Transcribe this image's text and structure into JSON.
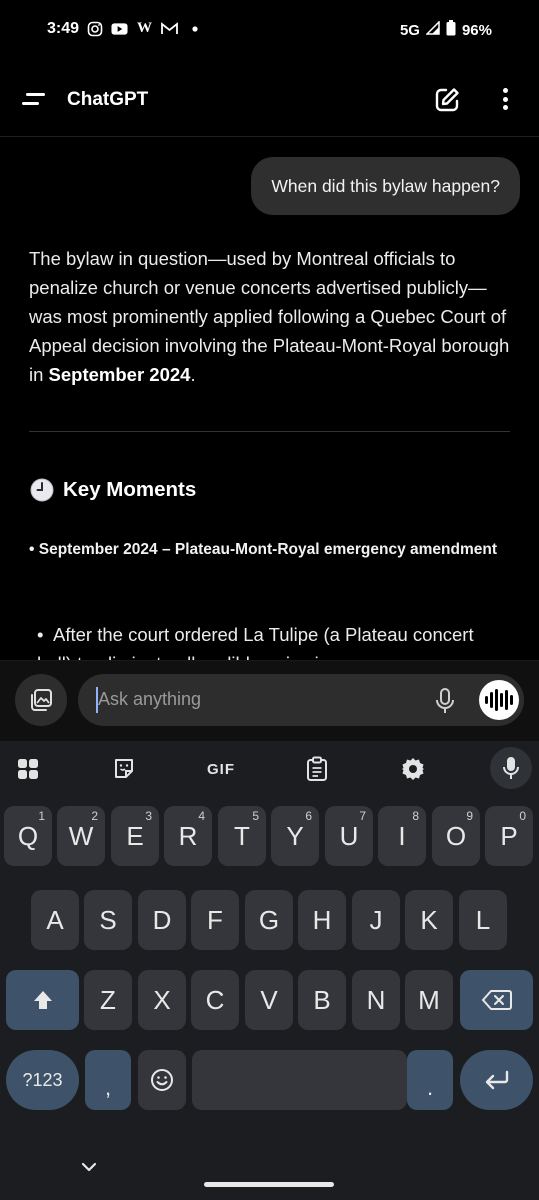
{
  "status_bar": {
    "time": "3:49",
    "notif_icons": [
      "instagram-icon",
      "youtube-icon",
      "w-icon",
      "gmail-icon",
      "dot-icon"
    ],
    "network": "5G",
    "battery": "96%"
  },
  "app_bar": {
    "title": "ChatGPT"
  },
  "chat": {
    "user_message": "When did this bylaw happen?",
    "answer_prefix": "The bylaw in question—used by Montreal officials to penalize church or venue concerts advertised publicly—was most prominently applied following a Quebec Court of Appeal decision involving the Plateau-Mont-Royal borough in ",
    "answer_bold": "September 2024",
    "answer_suffix": ".",
    "section_title": "Key Moments",
    "section_emoji": "🕒",
    "item_heading": "• September 2024 – Plateau-Mont-Royal emergency amendment",
    "bullet_text": "After the court ordered La Tulipe (a Plateau concert hall) to eliminate all audible noise in a"
  },
  "composer": {
    "placeholder": "Ask anything"
  },
  "keyboard": {
    "tools": [
      "apps-grid-icon",
      "sticker-icon",
      "GIF",
      "clipboard-icon",
      "gear-icon",
      "mic-icon"
    ],
    "row1": [
      {
        "k": "Q",
        "n": "1"
      },
      {
        "k": "W",
        "n": "2"
      },
      {
        "k": "E",
        "n": "3"
      },
      {
        "k": "R",
        "n": "4"
      },
      {
        "k": "T",
        "n": "5"
      },
      {
        "k": "Y",
        "n": "6"
      },
      {
        "k": "U",
        "n": "7"
      },
      {
        "k": "I",
        "n": "8"
      },
      {
        "k": "O",
        "n": "9"
      },
      {
        "k": "P",
        "n": "0"
      }
    ],
    "row2": [
      "A",
      "S",
      "D",
      "F",
      "G",
      "H",
      "J",
      "K",
      "L"
    ],
    "row3": [
      "Z",
      "X",
      "C",
      "V",
      "B",
      "N",
      "M"
    ],
    "symbols_key": "?123",
    "comma_key": ",",
    "period_key": "."
  },
  "colors": {
    "background": "#000000",
    "user_bubble": "#2f2f2f",
    "keyboard_bg": "#1b1d21",
    "key_bg": "#34363b",
    "function_key": "#3e5369"
  }
}
